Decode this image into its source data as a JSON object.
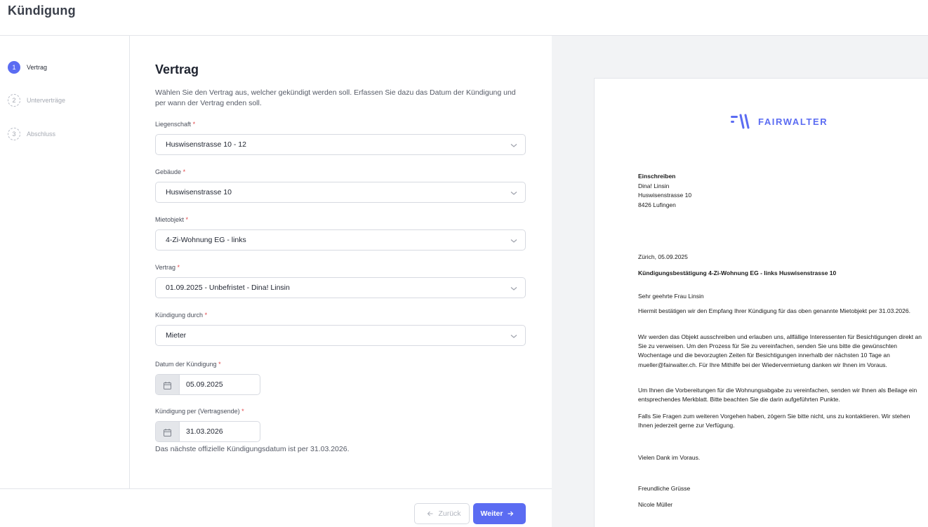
{
  "header": {
    "title": "Kündigung"
  },
  "steps": [
    {
      "num": "1",
      "label": "Vertrag",
      "state": "active"
    },
    {
      "num": "2",
      "label": "Unterverträge",
      "state": "inactive"
    },
    {
      "num": "3",
      "label": "Abschluss",
      "state": "inactive"
    }
  ],
  "form": {
    "heading": "Vertrag",
    "intro": "Wählen Sie den Vertrag aus, welcher gekündigt werden soll. Erfassen Sie dazu das Datum der Kündigung und per wann der Vertrag enden soll.",
    "required_mark": "*",
    "fields": {
      "liegenschaft": {
        "label": "Liegenschaft",
        "value": "Huswisenstrasse 10 - 12"
      },
      "gebaeude": {
        "label": "Gebäude",
        "value": "Huswisenstrasse 10"
      },
      "mietobjekt": {
        "label": "Mietobjekt",
        "value": "4-Zi-Wohnung EG - links"
      },
      "vertrag": {
        "label": "Vertrag",
        "value": "01.09.2025 - Unbefristet - Dina! Linsin"
      },
      "kuendigung_durch": {
        "label": "Kündigung durch",
        "value": "Mieter"
      },
      "datum": {
        "label": "Datum der Kündigung",
        "value": "05.09.2025"
      },
      "per": {
        "label": "Kündigung per (Vertragsende)",
        "value": "31.03.2026"
      }
    },
    "hint": "Das nächste offizielle Kündigungsdatum ist per 31.03.2026."
  },
  "footer": {
    "back_label": "Zurück",
    "next_label": "Weiter"
  },
  "preview": {
    "logo_text": "FAIRWALTER",
    "address": {
      "title": "Einschreiben",
      "name": "Dina! Linsin",
      "street": "Huswisenstrasse 10",
      "city": "8426 Lufingen"
    },
    "date_line": "Zürich, 05.09.2025",
    "subject": "Kündigungsbestätigung 4-Zi-Wohnung EG - links Huswisenstrasse 10",
    "greeting": "Sehr geehrte Frau Linsin",
    "p1": "Hiermit bestätigen wir den Empfang Ihrer Kündigung für das oben genannte Mietobjekt per 31.03.2026.",
    "p2": "Wir werden das Objekt ausschreiben und erlauben uns, allfällige Interessenten für Besichtigungen direkt an Sie zu verweisen. Um den Prozess für Sie zu vereinfachen, senden Sie uns bitte die gewünschten Wochentage und die bevorzugten Zeiten für Besichtigungen innerhalb der nächsten 10 Tage an mueller@fairwalter.ch. Für Ihre Mithilfe bei der Wiedervermietung danken wir Ihnen im Voraus.",
    "p3": "Um Ihnen die Vorbereitungen für die Wohnungsabgabe zu vereinfachen, senden wir Ihnen als Beilage ein entsprechendes Merkblatt. Bitte beachten Sie die darin aufgeführten Punkte.",
    "p4": "Falls Sie Fragen zum weiteren Vorgehen haben, zögern Sie bitte nicht, uns zu kontaktieren. Wir stehen Ihnen jederzeit gerne zur Verfügung.",
    "thanks": "Vielen Dank im Voraus.",
    "closing": "Freundliche Grüsse",
    "signature": "Nicole Müller"
  },
  "colors": {
    "accent": "#5b6cf2",
    "required": "#e2474b"
  }
}
